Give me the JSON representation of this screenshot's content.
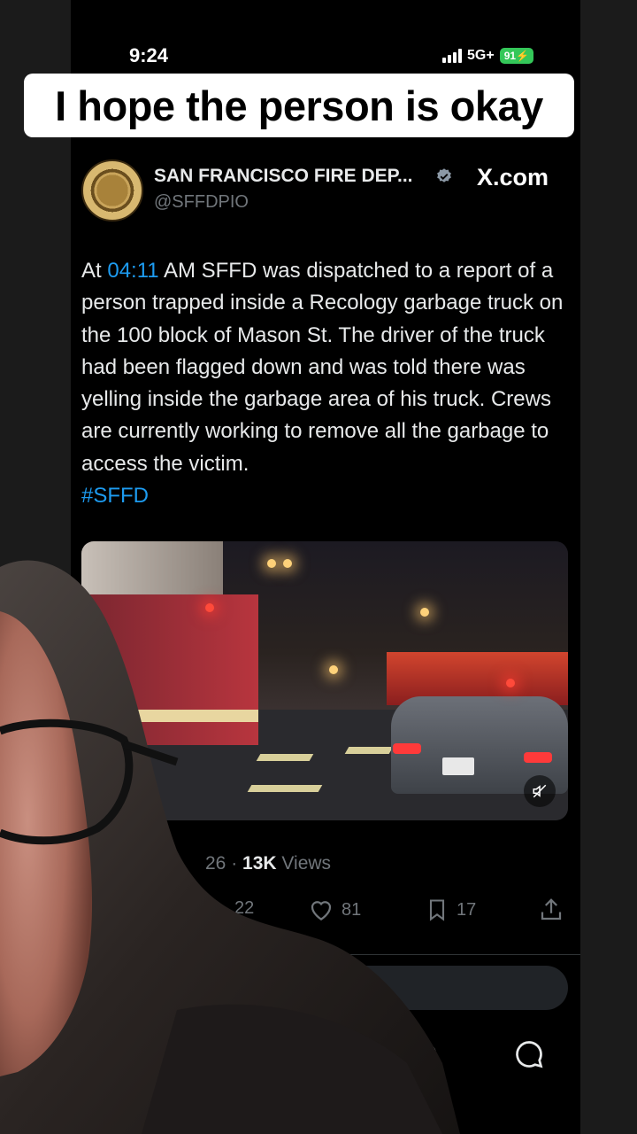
{
  "status_bar": {
    "time": "9:24",
    "network": "5G+",
    "battery": "91"
  },
  "caption": {
    "text": "I hope the person is okay"
  },
  "tweet": {
    "account_name": "SAN FRANCISCO FIRE DEP...",
    "handle": "@SFFDPIO",
    "source_label": "X.com",
    "body_before_time": "At ",
    "body_time": "04:11",
    "body_after_time": " AM SFFD was dispatched to a report of a person trapped inside a Recology garbage truck on the 100 block of Mason St. The driver of the truck had been flagged down and was told there was yelling inside the garbage area of his truck. Crews are currently working to remove all the garbage to access the victim.",
    "hashtag": "#SFFD",
    "media_alt": "Fire trucks and a car on a city street at night",
    "stats": {
      "date_fragment": "26",
      "separator": "·",
      "views_count": "13K",
      "views_label": "Views"
    },
    "actions": {
      "retweets_fragment": "22",
      "likes": "81",
      "bookmarks": "17"
    }
  },
  "colors": {
    "accent": "#1d9bf0",
    "caption_bg": "#ffffff",
    "battery": "#34c759"
  },
  "icons": [
    "signal-icon",
    "verified-icon",
    "mute-icon",
    "heart-icon",
    "bookmark-icon",
    "share-icon",
    "bell-icon",
    "message-icon"
  ]
}
